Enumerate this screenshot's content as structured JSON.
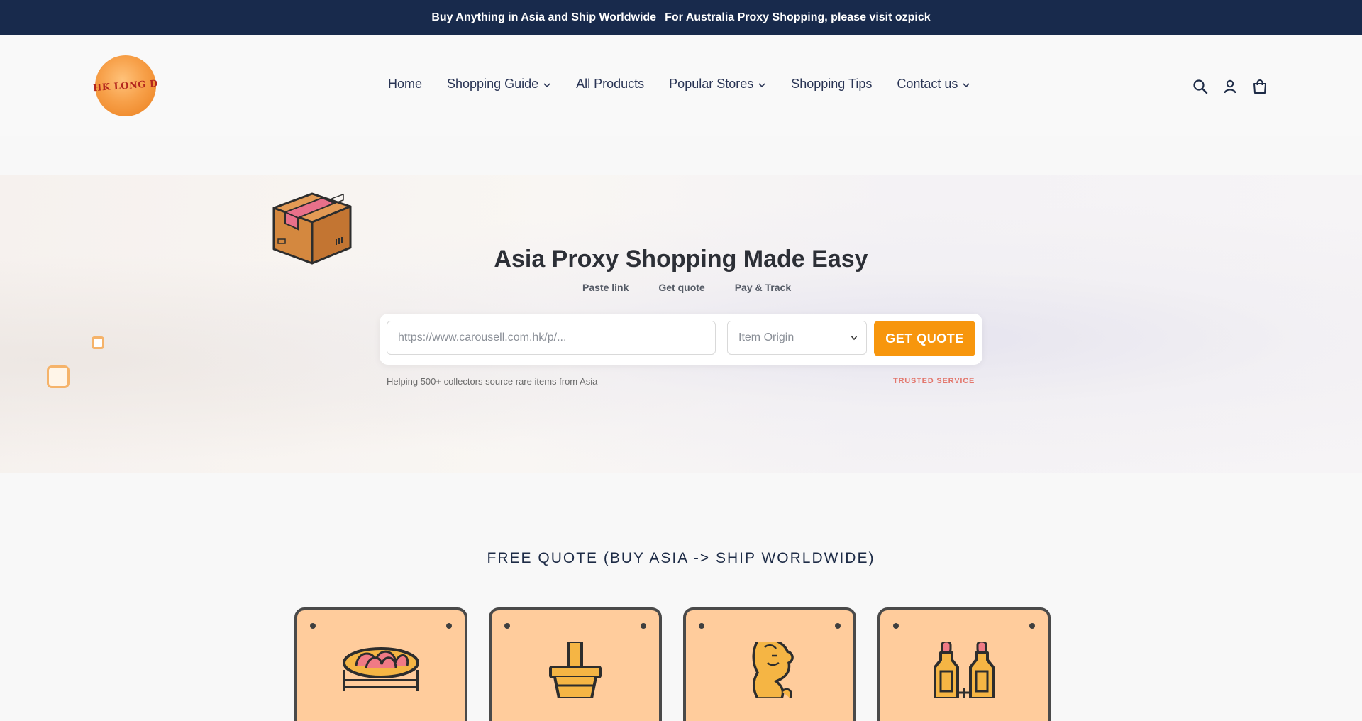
{
  "announcement": {
    "left_text": "Buy Anything in Asia and Ship Worldwide",
    "right_text": "For Australia Proxy Shopping, please visit ozpick"
  },
  "logo": {
    "text": "HK LONG D"
  },
  "nav": {
    "items": [
      {
        "label": "Home",
        "active": true,
        "dropdown": false
      },
      {
        "label": "Shopping Guide",
        "active": false,
        "dropdown": true
      },
      {
        "label": "All Products",
        "active": false,
        "dropdown": false
      },
      {
        "label": "Popular Stores",
        "active": false,
        "dropdown": true
      },
      {
        "label": "Shopping Tips",
        "active": false,
        "dropdown": false
      },
      {
        "label": "Contact us",
        "active": false,
        "dropdown": true
      }
    ]
  },
  "header_icons": [
    "search-icon",
    "account-icon",
    "cart-icon"
  ],
  "hero": {
    "title": "Asia Proxy Shopping Made Easy",
    "steps": [
      "Paste link",
      "Get quote",
      "Pay & Track"
    ],
    "url_placeholder": "https://www.carousell.com.hk/p/...",
    "origin_select": "Item Origin",
    "button_label": "GET QUOTE",
    "helper_text": "Helping 500+ collectors source rare items from Asia",
    "trusted_label": "TRUSTED SERVICE"
  },
  "quote_section": {
    "title": "FREE QUOTE (BUY ASIA -> SHIP WORLDWIDE)",
    "cards": [
      "dim-sum-icon",
      "bubble-tea-icon",
      "merlion-icon",
      "sauce-bottles-icon"
    ]
  },
  "colors": {
    "announcement_bg": "#182a4c",
    "accent": "#f7960d",
    "card_bg": "#ffcc9c",
    "trusted": "#e3766c"
  }
}
